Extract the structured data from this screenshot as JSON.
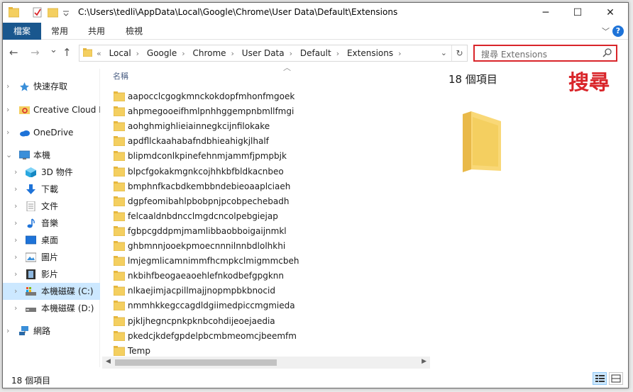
{
  "titlebar": {
    "title": "C:\\Users\\tedli\\AppData\\Local\\Google\\Chrome\\User Data\\Default\\Extensions",
    "minimize": "─",
    "maximize": "☐",
    "close": "✕"
  },
  "ribbon": {
    "tabs": [
      "檔案",
      "常用",
      "共用",
      "檢視"
    ],
    "collapse": "﹀",
    "help": "?"
  },
  "nav": {
    "back": "←",
    "forward": "→",
    "recent": "⌄",
    "up": "↑"
  },
  "address": {
    "overflow": "«",
    "crumbs": [
      "Local",
      "Google",
      "Chrome",
      "User Data",
      "Default",
      "Extensions"
    ],
    "separator": "›",
    "dropdown": "⌄",
    "refresh": "↻"
  },
  "search": {
    "placeholder": "搜尋 Extensions",
    "annotation": "搜尋"
  },
  "sidebar": {
    "items": [
      {
        "label": "快速存取",
        "icon": "star-icon",
        "level": 0
      },
      {
        "label": "Creative Cloud Files",
        "icon": "creative-cloud-icon",
        "level": 0
      },
      {
        "label": "OneDrive",
        "icon": "onedrive-icon",
        "level": 0
      },
      {
        "label": "本機",
        "icon": "computer-icon",
        "level": 0,
        "expanded": true
      },
      {
        "label": "3D 物件",
        "icon": "cube-icon",
        "level": 1
      },
      {
        "label": "下載",
        "icon": "download-icon",
        "level": 1
      },
      {
        "label": "文件",
        "icon": "document-icon",
        "level": 1
      },
      {
        "label": "音樂",
        "icon": "music-icon",
        "level": 1
      },
      {
        "label": "桌面",
        "icon": "desktop-icon",
        "level": 1
      },
      {
        "label": "圖片",
        "icon": "pictures-icon",
        "level": 1
      },
      {
        "label": "影片",
        "icon": "video-icon",
        "level": 1
      },
      {
        "label": "本機磁碟 (C:)",
        "icon": "drive-c-icon",
        "level": 1,
        "selected": true
      },
      {
        "label": "本機磁碟 (D:)",
        "icon": "drive-icon",
        "level": 1
      },
      {
        "label": "網路",
        "icon": "network-icon",
        "level": 0
      }
    ]
  },
  "filelist": {
    "column_header": "名稱",
    "sort_indicator": "︿",
    "files": [
      "aapocclcgogkmnckokdopfmhonfmgoek",
      "ahpmegooeifhmlpnhhggempnbmllfmgi",
      "aohghmighlieiainnegkcijnfilokake",
      "apdfllckaahabafndbhieahigkjlhalf",
      "blipmdconlkpinefehnmjammfjpmpbjk",
      "blpcfgokakmgnkcojhhkbfbldkacnbeo",
      "bmphnfkacbdkembbndebieoaaplciaeh",
      "dgpfeomibahlpbobpnjpcobpechebadh",
      "felcaaldnbdncclmgdcncolpebgiejap",
      "fgbpcgddpmjmamlibbaobboigaijnmkl",
      "ghbmnnjooekpmoecnnnilnnbdlolhkhi",
      "lmjegmlicamnimmfhcmpkclmigmmcbeh",
      "nkbihfbeogaeaoehlefnkodbefgpgknn",
      "nlkaejimjacpillmajjnopmpbkbnocid",
      "nmmhkkegccagdldgiimedpiccmgmieda",
      "pjkljhegncpnkpknbcohdijeoejaedia",
      "pkedcjkdefgpdelpbcmbmeomcjbeemfm",
      "Temp"
    ]
  },
  "scrollbar": {
    "left": "◀",
    "right": "▶"
  },
  "preview": {
    "item_count": "18 個項目"
  },
  "status": {
    "item_count": "18 個項目"
  },
  "colors": {
    "file_tab": "#19578e",
    "folder": "#f4cf60",
    "selection": "#cce8ff",
    "highlight": "#d9252a"
  }
}
